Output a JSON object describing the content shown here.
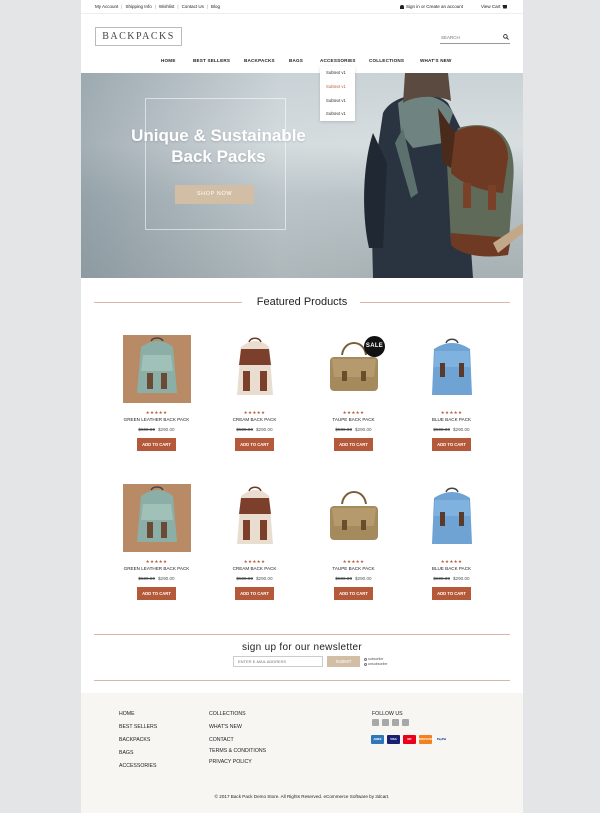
{
  "topbar": {
    "links": [
      "My Account",
      "Shipping Info",
      "Wishlist",
      "Contact Us",
      "Blog"
    ],
    "signin": "Sign in or Create an account",
    "cart": "View Cart"
  },
  "header": {
    "logo": "BACKPACKS",
    "search_placeholder": "SEARCH"
  },
  "nav": {
    "items": [
      "HOME",
      "BEST SELLERS",
      "BACKPACKS",
      "BAGS",
      "ACCESSORIES",
      "COLLECTIONS",
      "WHAT'S NEW"
    ],
    "dropdown": [
      "Subtext v1",
      "Subtext v1",
      "Subtext v1",
      "Subtext v1"
    ]
  },
  "hero": {
    "title_line1": "Unique & Sustainable",
    "title_line2": "Back Packs",
    "button": "SHOP NOW"
  },
  "featured": {
    "title": "Featured Products",
    "stars": "★★★★★",
    "sale_badge": "SALE",
    "add_to_cart": "ADD TO CART",
    "products": [
      {
        "name": "GREEN LEATHER BACK PACK",
        "old_price": "$500.00",
        "price": "$290.00"
      },
      {
        "name": "CREAM BACK PACK",
        "old_price": "$500.00",
        "price": "$290.00"
      },
      {
        "name": "TAUPE BACK PACK",
        "old_price": "$500.00",
        "price": "$290.00"
      },
      {
        "name": "BLUE BACK PACK",
        "old_price": "$500.00",
        "price": "$290.00"
      },
      {
        "name": "GREEN LEATHER BACK PACK",
        "old_price": "$500.00",
        "price": "$290.00"
      },
      {
        "name": "CREAM BACK PACK",
        "old_price": "$500.00",
        "price": "$290.00"
      },
      {
        "name": "TAUPE BACK PACK",
        "old_price": "$500.00",
        "price": "$290.00"
      },
      {
        "name": "BLUE BACK PACK",
        "old_price": "$500.00",
        "price": "$290.00"
      }
    ]
  },
  "newsletter": {
    "title": "sign up for our newsletter",
    "placeholder": "ENTER E-MAIL ADDRESS",
    "submit": "SUBMIT",
    "option1": "subscribe",
    "option2": "unsubscribe"
  },
  "footer": {
    "col1": [
      "HOME",
      "BEST SELLERS",
      "BACKPACKS",
      "BAGS",
      "ACCESSORIES"
    ],
    "col2": [
      "COLLECTIONS",
      "WHAT'S NEW",
      "CONTACT",
      "TERMS & CONDITIONS",
      "PRIVACY POLICY"
    ],
    "follow_title": "FOLLOW US",
    "payments": [
      "AMEX",
      "VISA",
      "MC",
      "DISCOVER",
      "PayPal"
    ],
    "copyright": "© 2017 Back Pack Demo Store. All Rights Reserved. eCommerce Software by 3dcart."
  },
  "colors": {
    "accent": "#b45a3a",
    "hero_button": "#d2bea4",
    "stars": "#b85e3e",
    "footer_bg": "#f8f6f2"
  }
}
